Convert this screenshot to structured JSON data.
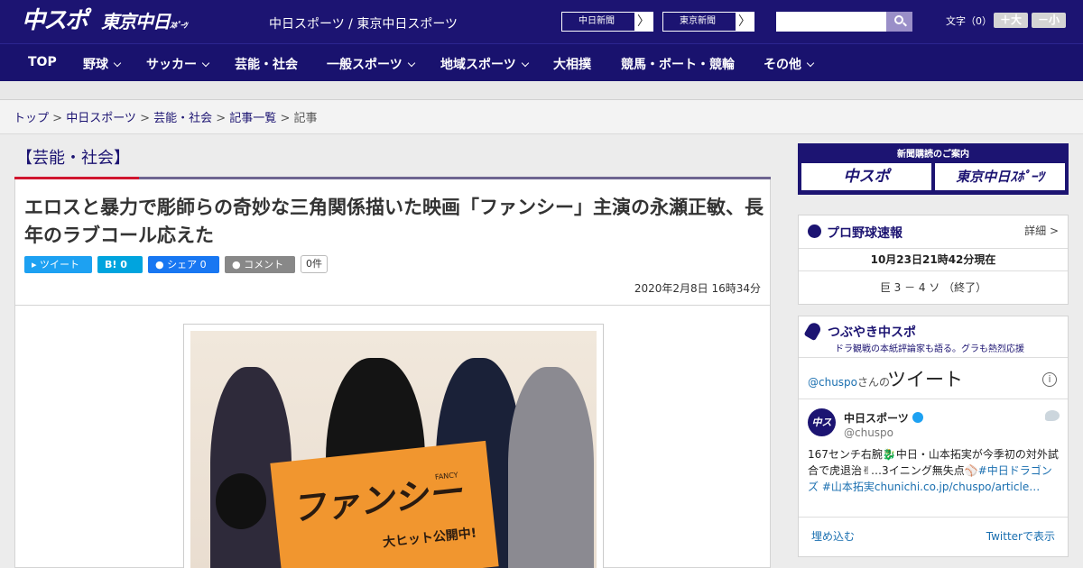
{
  "header": {
    "logo_primary": "中スポ",
    "logo_secondary": "東京中日",
    "logo_secondary_small": "ｽﾎﾟｰﾂ",
    "site_links": "中日スポーツ / 東京中日スポーツ",
    "ext_link_1": "中日新聞",
    "ext_link_2": "東京新聞",
    "ext_arrow": "〉",
    "search_placeholder": "",
    "font_size_label": "文字（0）",
    "font_plus": "＋大",
    "font_minus": "－小"
  },
  "nav": {
    "items": [
      "TOP",
      "野球",
      "サッカー",
      "芸能・社会",
      "一般スポーツ",
      "地域スポーツ",
      "大相撲",
      "競馬・ボート・競輪",
      "その他"
    ]
  },
  "breadcrumb": {
    "items": [
      "トップ",
      "中日スポーツ",
      "芸能・社会",
      "記事一覧"
    ],
    "current": "記事",
    "sep": " > "
  },
  "article": {
    "category": "【芸能・社会】",
    "headline": "エロスと暴力で彫師らの奇妙な三角関係描いた映画「ファンシー」主演の永瀬正敏、長年のラブコール応えた",
    "share": {
      "tweet": "ツイート",
      "hatena": "B! 0",
      "facebook": "シェア 0",
      "comment": "コメント",
      "comment_count": "0件"
    },
    "date": "2020年2月8日 16時34分",
    "photo": {
      "sign_text": "ファンシー",
      "sign_sub": "大ヒット公開中!",
      "sign_fancy": "FANCY"
    }
  },
  "sidebar": {
    "subscribe": {
      "title": "新聞購読のご案内",
      "btn1": "中スポ",
      "btn2": "東京中日ｽﾎﾟｰﾂ"
    },
    "baseball": {
      "title": "プロ野球速報",
      "detail": "詳細 >",
      "timestamp": "10月23日21時42分現在",
      "score": "巨 3 － 4 ソ （終了）"
    },
    "tweets": {
      "title": "つぶやき中スポ",
      "subtitle": "ドラ観戦の本紙評論家も語る。グラも熱烈応援",
      "handle": "@chuspo",
      "handle_suffix": "さんの",
      "tweet_word": "ツイート",
      "info": "i",
      "avatar": "中スポ",
      "account_name": "中日スポーツ",
      "account_handle": "@chuspo",
      "tweet_text": "167センチ右腕🐉中日・山本拓実が今季初の対外試合で虎退治✌…3イニング無失点⚾",
      "tweet_tags": "#中日ドラゴンズ #山本拓実chunichi.co.jp/chuspo/article…",
      "embed": "埋め込む",
      "view_on": "Twitterで表示"
    }
  },
  "colors": {
    "brand_navy": "#1c1472",
    "accent_red": "#d0162f",
    "twitter_blue": "#1da1f2",
    "facebook_blue": "#1877f2",
    "hatena_blue": "#00a4de",
    "sign_orange": "#f1962f"
  }
}
